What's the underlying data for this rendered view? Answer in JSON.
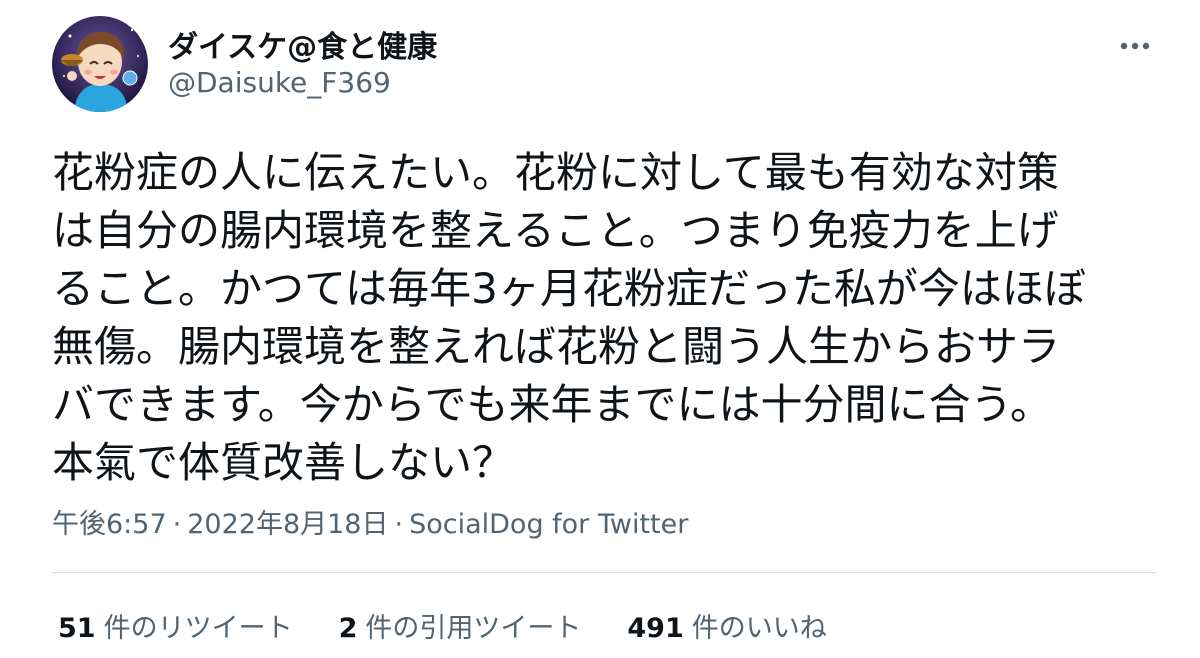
{
  "user": {
    "display_name": "ダイスケ@食と健康",
    "handle": "@Daisuke_F369"
  },
  "more_icon": "ellipsis-horizontal-icon",
  "tweet": {
    "lines": [
      "花粉症の人に伝えたい。花粉に対して最も有効な対策",
      "は自分の腸内環境を整えること。つまり免疫力を上げ",
      "ること。かつては毎年3ヶ月花粉症だった私が今はほぼ",
      "無傷。腸内環境を整えれば花粉と闘う人生からおサラ",
      "バできます。今からでも来年までには十分間に合う。",
      "本氣で体質改善しない？"
    ]
  },
  "meta": {
    "time": "午後6:57",
    "separator": "·",
    "date": "2022年8月18日",
    "source": "SocialDog for Twitter"
  },
  "stats": {
    "retweets_count": "51",
    "retweets_label": "件のリツイート",
    "quotes_count": "2",
    "quotes_label": "件の引用ツイート",
    "likes_count": "491",
    "likes_label": "件のいいね"
  },
  "colors": {
    "text_primary": "#0f1419",
    "text_secondary": "#536471",
    "divider": "#cfd9de"
  }
}
